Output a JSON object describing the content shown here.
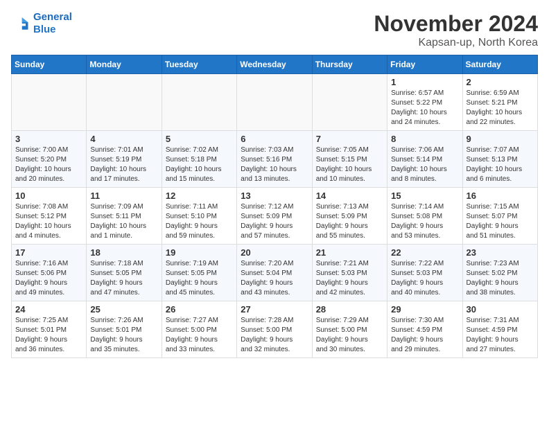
{
  "header": {
    "logo_line1": "General",
    "logo_line2": "Blue",
    "month": "November 2024",
    "location": "Kapsan-up, North Korea"
  },
  "weekdays": [
    "Sunday",
    "Monday",
    "Tuesday",
    "Wednesday",
    "Thursday",
    "Friday",
    "Saturday"
  ],
  "weeks": [
    [
      {
        "day": "",
        "info": ""
      },
      {
        "day": "",
        "info": ""
      },
      {
        "day": "",
        "info": ""
      },
      {
        "day": "",
        "info": ""
      },
      {
        "day": "",
        "info": ""
      },
      {
        "day": "1",
        "info": "Sunrise: 6:57 AM\nSunset: 5:22 PM\nDaylight: 10 hours\nand 24 minutes."
      },
      {
        "day": "2",
        "info": "Sunrise: 6:59 AM\nSunset: 5:21 PM\nDaylight: 10 hours\nand 22 minutes."
      }
    ],
    [
      {
        "day": "3",
        "info": "Sunrise: 7:00 AM\nSunset: 5:20 PM\nDaylight: 10 hours\nand 20 minutes."
      },
      {
        "day": "4",
        "info": "Sunrise: 7:01 AM\nSunset: 5:19 PM\nDaylight: 10 hours\nand 17 minutes."
      },
      {
        "day": "5",
        "info": "Sunrise: 7:02 AM\nSunset: 5:18 PM\nDaylight: 10 hours\nand 15 minutes."
      },
      {
        "day": "6",
        "info": "Sunrise: 7:03 AM\nSunset: 5:16 PM\nDaylight: 10 hours\nand 13 minutes."
      },
      {
        "day": "7",
        "info": "Sunrise: 7:05 AM\nSunset: 5:15 PM\nDaylight: 10 hours\nand 10 minutes."
      },
      {
        "day": "8",
        "info": "Sunrise: 7:06 AM\nSunset: 5:14 PM\nDaylight: 10 hours\nand 8 minutes."
      },
      {
        "day": "9",
        "info": "Sunrise: 7:07 AM\nSunset: 5:13 PM\nDaylight: 10 hours\nand 6 minutes."
      }
    ],
    [
      {
        "day": "10",
        "info": "Sunrise: 7:08 AM\nSunset: 5:12 PM\nDaylight: 10 hours\nand 4 minutes."
      },
      {
        "day": "11",
        "info": "Sunrise: 7:09 AM\nSunset: 5:11 PM\nDaylight: 10 hours\nand 1 minute."
      },
      {
        "day": "12",
        "info": "Sunrise: 7:11 AM\nSunset: 5:10 PM\nDaylight: 9 hours\nand 59 minutes."
      },
      {
        "day": "13",
        "info": "Sunrise: 7:12 AM\nSunset: 5:09 PM\nDaylight: 9 hours\nand 57 minutes."
      },
      {
        "day": "14",
        "info": "Sunrise: 7:13 AM\nSunset: 5:09 PM\nDaylight: 9 hours\nand 55 minutes."
      },
      {
        "day": "15",
        "info": "Sunrise: 7:14 AM\nSunset: 5:08 PM\nDaylight: 9 hours\nand 53 minutes."
      },
      {
        "day": "16",
        "info": "Sunrise: 7:15 AM\nSunset: 5:07 PM\nDaylight: 9 hours\nand 51 minutes."
      }
    ],
    [
      {
        "day": "17",
        "info": "Sunrise: 7:16 AM\nSunset: 5:06 PM\nDaylight: 9 hours\nand 49 minutes."
      },
      {
        "day": "18",
        "info": "Sunrise: 7:18 AM\nSunset: 5:05 PM\nDaylight: 9 hours\nand 47 minutes."
      },
      {
        "day": "19",
        "info": "Sunrise: 7:19 AM\nSunset: 5:05 PM\nDaylight: 9 hours\nand 45 minutes."
      },
      {
        "day": "20",
        "info": "Sunrise: 7:20 AM\nSunset: 5:04 PM\nDaylight: 9 hours\nand 43 minutes."
      },
      {
        "day": "21",
        "info": "Sunrise: 7:21 AM\nSunset: 5:03 PM\nDaylight: 9 hours\nand 42 minutes."
      },
      {
        "day": "22",
        "info": "Sunrise: 7:22 AM\nSunset: 5:03 PM\nDaylight: 9 hours\nand 40 minutes."
      },
      {
        "day": "23",
        "info": "Sunrise: 7:23 AM\nSunset: 5:02 PM\nDaylight: 9 hours\nand 38 minutes."
      }
    ],
    [
      {
        "day": "24",
        "info": "Sunrise: 7:25 AM\nSunset: 5:01 PM\nDaylight: 9 hours\nand 36 minutes."
      },
      {
        "day": "25",
        "info": "Sunrise: 7:26 AM\nSunset: 5:01 PM\nDaylight: 9 hours\nand 35 minutes."
      },
      {
        "day": "26",
        "info": "Sunrise: 7:27 AM\nSunset: 5:00 PM\nDaylight: 9 hours\nand 33 minutes."
      },
      {
        "day": "27",
        "info": "Sunrise: 7:28 AM\nSunset: 5:00 PM\nDaylight: 9 hours\nand 32 minutes."
      },
      {
        "day": "28",
        "info": "Sunrise: 7:29 AM\nSunset: 5:00 PM\nDaylight: 9 hours\nand 30 minutes."
      },
      {
        "day": "29",
        "info": "Sunrise: 7:30 AM\nSunset: 4:59 PM\nDaylight: 9 hours\nand 29 minutes."
      },
      {
        "day": "30",
        "info": "Sunrise: 7:31 AM\nSunset: 4:59 PM\nDaylight: 9 hours\nand 27 minutes."
      }
    ]
  ]
}
